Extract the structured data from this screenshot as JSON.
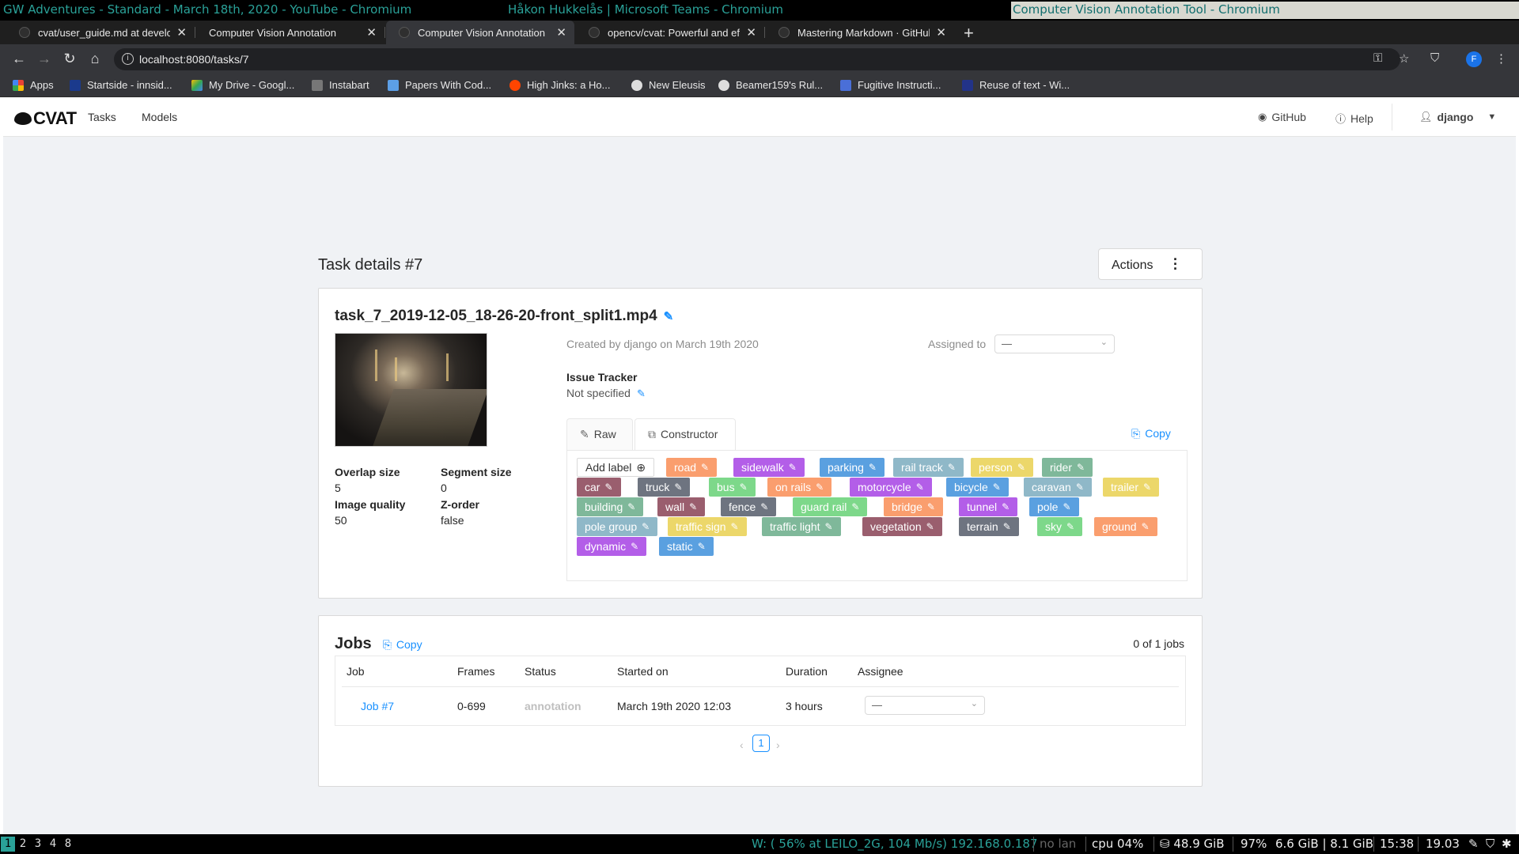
{
  "wm": {
    "title_1": "GW Adventures - Standard - March 18th, 2020 - YouTube - Chromium",
    "title_2": "Håkon Hukkelås | Microsoft Teams - Chromium",
    "title_3": "Computer Vision Annotation Tool - Chromium"
  },
  "browser": {
    "tabs": [
      {
        "label": "cvat/user_guide.md at develop"
      },
      {
        "label": "Computer Vision Annotation"
      },
      {
        "label": "Computer Vision Annotation"
      },
      {
        "label": "opencv/cvat: Powerful and ef"
      },
      {
        "label": "Mastering Markdown · GitHub"
      }
    ],
    "url": "localhost:8080/tasks/7",
    "profile_initial": "F",
    "bookmarks": [
      {
        "label": "Apps"
      },
      {
        "label": "Startside - innsid..."
      },
      {
        "label": "My Drive - Googl..."
      },
      {
        "label": "Instabart"
      },
      {
        "label": "Papers With Cod..."
      },
      {
        "label": "High Jinks: a Ho..."
      },
      {
        "label": "New Eleusis"
      },
      {
        "label": "Beamer159's Rul..."
      },
      {
        "label": "Fugitive Instructi..."
      },
      {
        "label": "Reuse of text - Wi..."
      }
    ]
  },
  "header": {
    "logo": "CVAT",
    "nav_tasks": "Tasks",
    "nav_models": "Models",
    "github": "GitHub",
    "help": "Help",
    "user": "django"
  },
  "task": {
    "page_title": "Task details #7",
    "actions_label": "Actions",
    "name": "task_7_2019-12-05_18-26-20-front_split1.mp4",
    "created": "Created by django on March 19th 2020",
    "assigned_to_label": "Assigned to",
    "assigned_to_value": "—",
    "issue_tracker_label": "Issue Tracker",
    "issue_tracker_value": "Not specified",
    "overlap_label": "Overlap size",
    "overlap_value": "5",
    "segment_label": "Segment size",
    "segment_value": "0",
    "quality_label": "Image quality",
    "quality_value": "50",
    "zorder_label": "Z-order",
    "zorder_value": "false",
    "tab_raw": "Raw",
    "tab_constructor": "Constructor",
    "copy_label": "Copy",
    "add_label": "Add label",
    "labels": [
      {
        "name": "road",
        "color": "#fa9e6e"
      },
      {
        "name": "sidewalk",
        "color": "#b35ee8"
      },
      {
        "name": "parking",
        "color": "#5aa0e0"
      },
      {
        "name": "rail track",
        "color": "#8fb8c8"
      },
      {
        "name": "person",
        "color": "#ecd76a"
      },
      {
        "name": "rider",
        "color": "#7fb89a"
      },
      {
        "name": "car",
        "color": "#9a5e6e"
      },
      {
        "name": "truck",
        "color": "#6e7480"
      },
      {
        "name": "bus",
        "color": "#7dd88a"
      },
      {
        "name": "on rails",
        "color": "#fa9e6e"
      },
      {
        "name": "motorcycle",
        "color": "#b35ee8"
      },
      {
        "name": "bicycle",
        "color": "#5aa0e0"
      },
      {
        "name": "caravan",
        "color": "#8fb8c8"
      },
      {
        "name": "trailer",
        "color": "#ecd76a"
      },
      {
        "name": "building",
        "color": "#7fb89a"
      },
      {
        "name": "wall",
        "color": "#9a5e6e"
      },
      {
        "name": "fence",
        "color": "#6e7480"
      },
      {
        "name": "guard rail",
        "color": "#7dd88a"
      },
      {
        "name": "bridge",
        "color": "#fa9e6e"
      },
      {
        "name": "tunnel",
        "color": "#b35ee8"
      },
      {
        "name": "pole",
        "color": "#5aa0e0"
      },
      {
        "name": "pole group",
        "color": "#8fb8c8"
      },
      {
        "name": "traffic sign",
        "color": "#ecd76a"
      },
      {
        "name": "traffic light",
        "color": "#7fb89a"
      },
      {
        "name": "vegetation",
        "color": "#9a5e6e"
      },
      {
        "name": "terrain",
        "color": "#6e7480"
      },
      {
        "name": "sky",
        "color": "#7dd88a"
      },
      {
        "name": "ground",
        "color": "#fa9e6e"
      },
      {
        "name": "dynamic",
        "color": "#b35ee8"
      },
      {
        "name": "static",
        "color": "#5aa0e0"
      }
    ]
  },
  "jobs": {
    "title": "Jobs",
    "copy_label": "Copy",
    "count": "0 of 1 jobs",
    "columns": [
      "Job",
      "Frames",
      "Status",
      "Started on",
      "Duration",
      "Assignee"
    ],
    "row": {
      "job": "Job #7",
      "frames": "0-699",
      "status": "annotation",
      "started": "March 19th 2020 12:03",
      "duration": "3 hours",
      "assignee": "—"
    },
    "page": "1"
  },
  "statusbar": {
    "workspaces": [
      "1",
      "2",
      "3",
      "4",
      "8"
    ],
    "wifi": "W: ( 56% at LEILO_2G, 104 Mb/s) 192.168.0.187",
    "lan": "no lan",
    "cpu": "cpu  04%",
    "disk": "48.9 GiB",
    "battery": "97%",
    "mem": "6.6 GiB | 8.1 GiB",
    "time": "15:38",
    "date": "19.03"
  }
}
